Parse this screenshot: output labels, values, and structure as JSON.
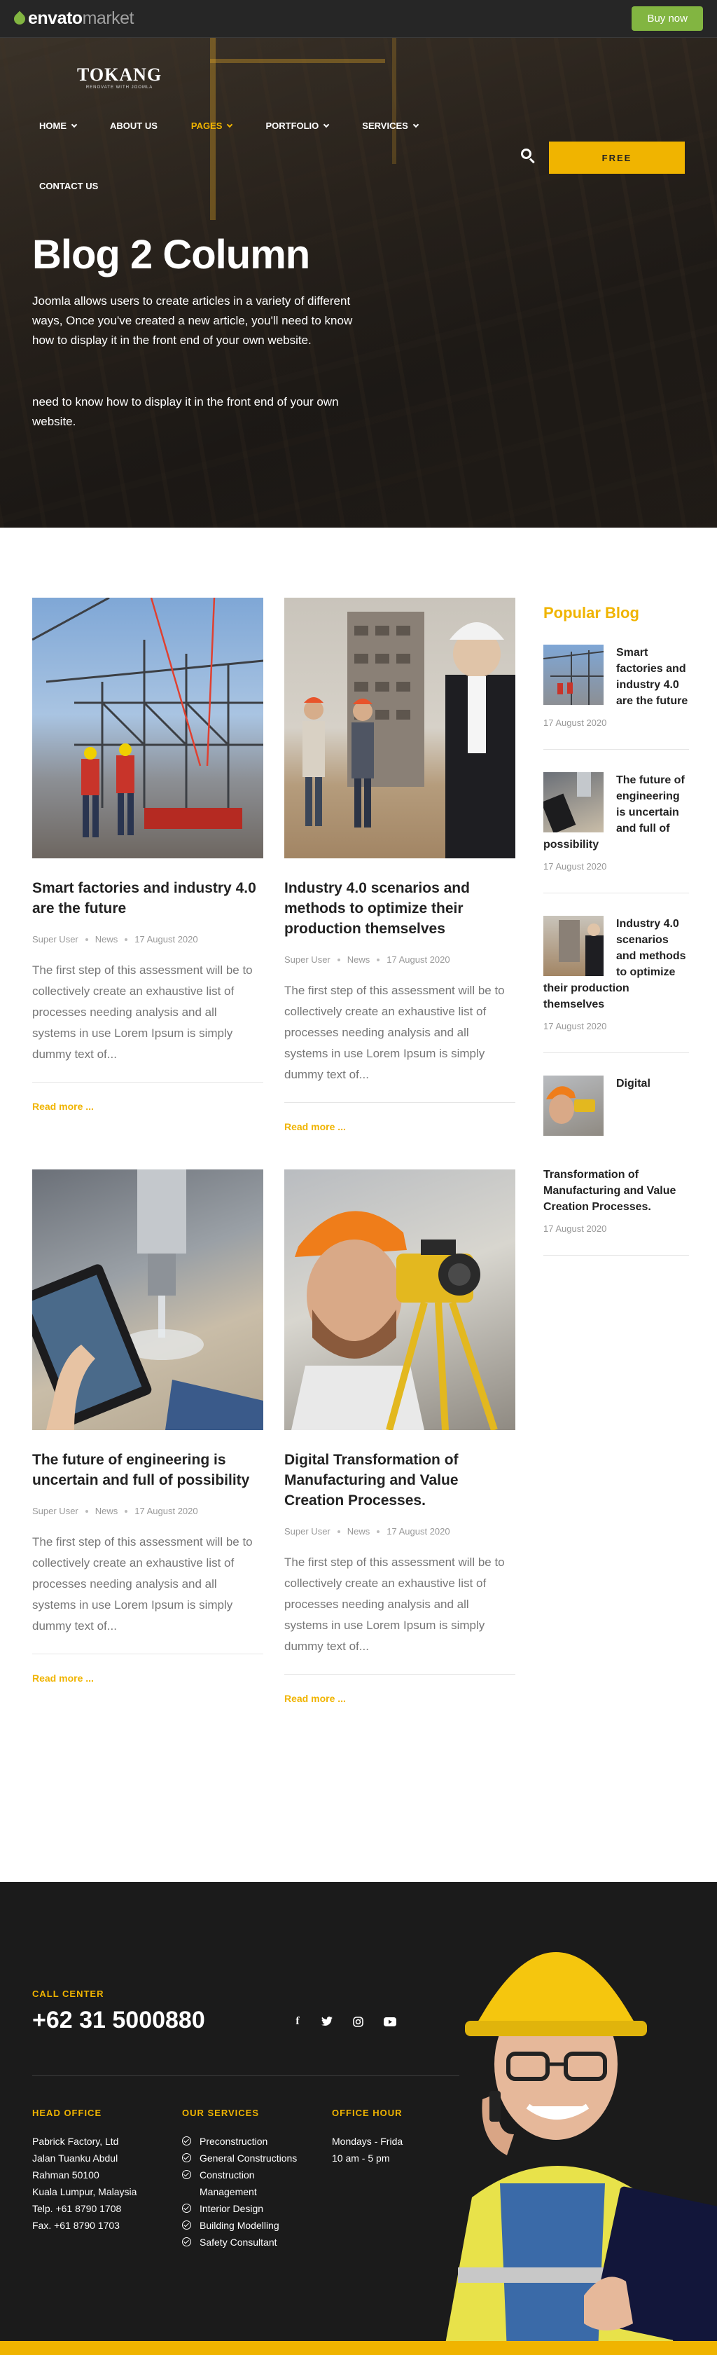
{
  "topbar": {
    "logo_main": "envato",
    "logo_sub": "market",
    "buy_label": "Buy now"
  },
  "header": {
    "logo_title": "TOKANG",
    "logo_tagline": "RENOVATE WITH JOOMLA",
    "nav": [
      {
        "label": "HOME",
        "has_dropdown": true
      },
      {
        "label": "ABOUT US",
        "has_dropdown": false
      },
      {
        "label": "PAGES",
        "has_dropdown": true,
        "active": true
      },
      {
        "label": "PORTFOLIO",
        "has_dropdown": true
      },
      {
        "label": "SERVICES",
        "has_dropdown": true
      },
      {
        "label": "CONTACT US",
        "has_dropdown": false
      }
    ],
    "free_label": "FREE",
    "search_icon": "search-icon"
  },
  "hero": {
    "title": "Blog 2 Column",
    "text": "Joomla allows users to create articles in a variety of different ways, Once you've created a new article, you'll need to know how to display it in the front end of your own website.",
    "text2": "need to know how to display it in the front end of your own website."
  },
  "posts": [
    {
      "title": "Smart factories and industry 4.0 are the future",
      "author": "Super User",
      "category": "News",
      "date": "17 August 2020",
      "excerpt": "The first step of this assessment will be to collectively create an exhaustive list of processes needing analysis and all systems in use Lorem Ipsum is simply dummy text of...",
      "more": "Read more ..."
    },
    {
      "title": "Industry 4.0 scenarios and methods to optimize their production themselves",
      "author": "Super User",
      "category": "News",
      "date": "17 August 2020",
      "excerpt": "The first step of this assessment will be to collectively create an exhaustive list of processes needing analysis and all systems in use Lorem Ipsum is simply dummy text of...",
      "more": "Read more ..."
    },
    {
      "title": "The future of engineering is uncertain and full of possibility",
      "author": "Super User",
      "category": "News",
      "date": "17 August 2020",
      "excerpt": "The first step of this assessment will be to collectively create an exhaustive list of processes needing analysis and all systems in use Lorem Ipsum is simply dummy text of...",
      "more": "Read more ..."
    },
    {
      "title": "Digital Transformation of Manufacturing and Value Creation Processes.",
      "author": "Super User",
      "category": "News",
      "date": "17 August 2020",
      "excerpt": "The first step of this assessment will be to collectively create an exhaustive list of processes needing analysis and all systems in use Lorem Ipsum is simply dummy text of...",
      "more": "Read more ..."
    }
  ],
  "sidebar": {
    "title": "Popular Blog",
    "items": [
      {
        "title": "Smart factories and industry 4.0 are the future",
        "date": "17 August 2020"
      },
      {
        "title": "The future of engineering is uncertain and full of possibility",
        "date": "17 August 2020"
      },
      {
        "title": "Industry 4.0 scenarios and methods to optimize their production themselves",
        "date": "17 August 2020"
      },
      {
        "title": "Digital",
        "title_rest": "Transformation of Manufacturing and Value Creation Processes.",
        "date": "17 August 2020"
      }
    ]
  },
  "footer": {
    "callcenter_label": "CALL CENTER",
    "phone": "+62 31 5000880",
    "social_icons": [
      "facebook-icon",
      "twitter-icon",
      "instagram-icon",
      "youtube-icon"
    ],
    "head_office_label": "HEAD OFFICE",
    "head_office_lines": [
      "Pabrick Factory, Ltd",
      "Jalan Tuanku Abdul",
      "Rahman 50100",
      "Kuala Lumpur, Malaysia",
      "Telp. +61 8790 1708",
      "Fax. +61 8790 1703"
    ],
    "services_label": "OUR SERVICES",
    "services": [
      "Preconstruction",
      "General Constructions",
      "Construction Management",
      "Interior Design",
      "Building Modelling",
      "Safety Consultant"
    ],
    "office_hour_label": "OFFICE HOUR",
    "office_hour_lines": [
      "Mondays - Frida",
      "10 am - 5 pm"
    ]
  },
  "colors": {
    "accent": "#f0b400",
    "dark": "#1b1b1b",
    "envato_green": "#82b541"
  }
}
